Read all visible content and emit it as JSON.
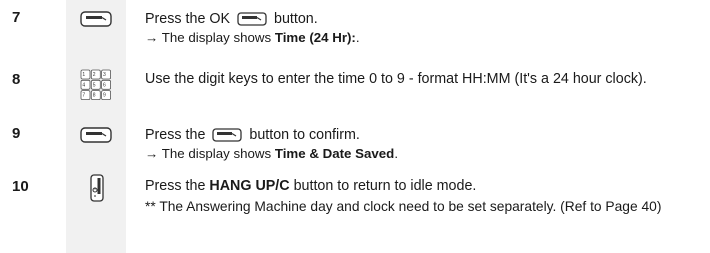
{
  "steps": [
    {
      "number": "7",
      "icon": "ok-button-icon",
      "line1_pre": "Press the OK",
      "line1_post": "button.",
      "line2_pre": "→ The display shows ",
      "line2_bold": "Time (24 Hr):",
      "line2_post": "."
    },
    {
      "number": "8",
      "icon": "keypad-icon",
      "text": "Use the digit keys to enter the time 0 to 9 - format HH:MM (It's a 24 hour clock).",
      "keypad_keys": [
        [
          "1",
          "2abc",
          "3def"
        ],
        [
          "4ghi",
          "5jkl",
          "6mno"
        ],
        [
          "7pqrs",
          "8tuv",
          "9wxyz"
        ]
      ]
    },
    {
      "number": "9",
      "icon": "ok-button-icon",
      "line1_pre": "Press the",
      "line1_post": "button to confirm.",
      "line2_pre": "→ The display shows ",
      "line2_bold": "Time & Date Saved",
      "line2_post": "."
    },
    {
      "number": "10",
      "icon": "hang-up-icon",
      "line1_pre": "Press the ",
      "line1_bold": "HANG UP/C",
      "line1_post": " button to return to idle mode.",
      "note": "** The Answering Machine day and clock need to be set separately. (Ref to Page 40)"
    }
  ],
  "colors": {
    "text": "#1a1a1a",
    "strip": "#f1f1f1",
    "icon": "#333333"
  }
}
